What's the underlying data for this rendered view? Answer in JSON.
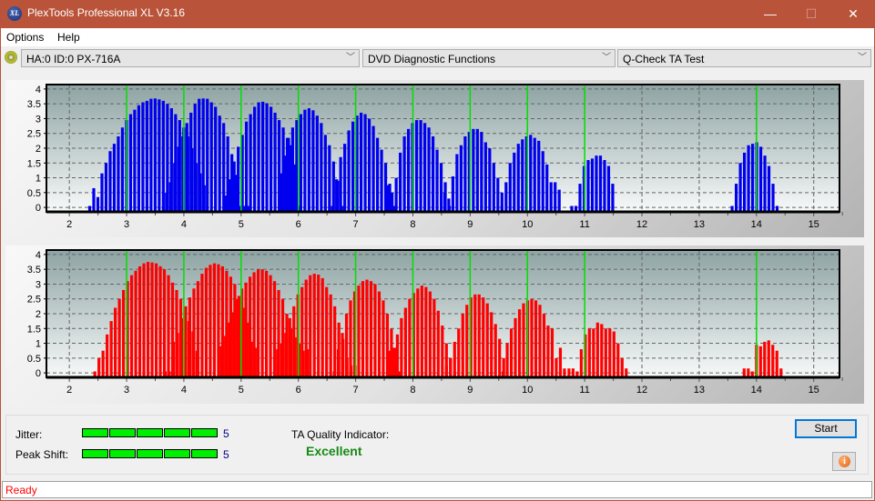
{
  "window": {
    "title": "PlexTools Professional XL V3.16",
    "app_icon_text": "XL",
    "minimize_glyph": "—",
    "maximize_glyph": "☐",
    "close_glyph": "✕"
  },
  "menu": [
    {
      "label": "Options"
    },
    {
      "label": "Help"
    }
  ],
  "toolbar": {
    "drive_select": "HA:0 ID:0  PX-716A",
    "function_select": "DVD Diagnostic Functions",
    "test_select": "Q-Check TA Test",
    "dropdown_glyph": "﹀"
  },
  "results": {
    "jitter_label": "Jitter:",
    "jitter_value": "5",
    "jitter_segments": 5,
    "peak_shift_label": "Peak Shift:",
    "peak_shift_value": "5",
    "peak_shift_segments": 5,
    "ta_label": "TA Quality Indicator:",
    "ta_value": "Excellent",
    "start_label": "Start",
    "info_glyph": "i"
  },
  "status": {
    "text": "Ready"
  },
  "colors": {
    "titlebar": "#b95339",
    "top_bars": "#0000ee",
    "bottom_bars": "#ff0000",
    "marker_lines": "#00e000",
    "meter_fill": "#00ee00",
    "quality_text": "#168a16",
    "status_text": "#ff0000"
  },
  "chart_data": [
    {
      "type": "bar",
      "name": "TA histogram (land / top)",
      "xlabel": "",
      "ylabel": "",
      "xlim": [
        1.6,
        15.45
      ],
      "ylim": [
        -0.15,
        4.15
      ],
      "xticks": [
        2,
        3,
        4,
        5,
        6,
        7,
        8,
        9,
        10,
        11,
        12,
        13,
        14,
        15
      ],
      "yticks": [
        0,
        0.5,
        1,
        1.5,
        2,
        2.5,
        3,
        3.5,
        4
      ],
      "ytick_labels": [
        "0",
        "0.5",
        "1",
        "1.5",
        "2",
        "2.5",
        "3",
        "3.5",
        "4"
      ],
      "grid": true,
      "reference_lines": [
        3,
        4,
        5,
        6,
        7,
        8,
        9,
        10,
        11,
        14
      ],
      "groups": [
        {
          "start": 2.33,
          "values": [
            0.05,
            0.65,
            0.35,
            1.15,
            1.5,
            1.9,
            2.15,
            2.4,
            2.7,
            2.95,
            3.15,
            3.3,
            3.45,
            3.55,
            3.6,
            3.67,
            3.68,
            3.65,
            3.6,
            3.5,
            3.35,
            3.15,
            2.95,
            2.7,
            2.4,
            2.0,
            1.5,
            1.15,
            0.75
          ]
        },
        {
          "start": 3.67,
          "values": [
            0.5,
            0.85,
            1.5,
            2.05,
            2.4,
            2.85,
            3.2,
            3.5,
            3.67,
            3.68,
            3.67,
            3.55,
            3.4,
            3.1,
            2.85,
            2.4,
            1.8,
            1.1,
            0.05,
            0.05,
            0.05
          ]
        },
        {
          "start": 4.71,
          "values": [
            0.4,
            0.95,
            1.55,
            2.05,
            2.45,
            2.9,
            3.15,
            3.4,
            3.55,
            3.57,
            3.52,
            3.4,
            3.2,
            2.95,
            2.7,
            2.35,
            2.1,
            1.45,
            0.05
          ]
        },
        {
          "start": 5.66,
          "values": [
            1.15,
            1.75,
            2.35,
            2.7,
            2.95,
            3.15,
            3.3,
            3.35,
            3.28,
            3.1,
            2.85,
            2.45,
            2.1,
            1.55,
            0.9,
            0.05
          ]
        },
        {
          "start": 6.57,
          "values": [
            0.05,
            0.95,
            1.7,
            2.15,
            2.6,
            2.9,
            3.1,
            3.2,
            3.15,
            3.0,
            2.75,
            2.35,
            1.95,
            1.5,
            0.8,
            0.05
          ]
        },
        {
          "start": 7.54,
          "values": [
            0.75,
            0.5,
            1.0,
            1.85,
            2.4,
            2.65,
            2.85,
            2.95,
            2.95,
            2.85,
            2.7,
            2.4,
            1.95,
            1.5,
            0.85,
            0.05
          ]
        },
        {
          "start": 8.53,
          "values": [
            0.5,
            0.3,
            1.05,
            1.8,
            2.1,
            2.4,
            2.55,
            2.65,
            2.65,
            2.55,
            2.2,
            2.0,
            1.5,
            1.0,
            0.05
          ]
        },
        {
          "start": 9.53,
          "values": [
            0.5,
            0.85,
            1.5,
            1.85,
            2.15,
            2.3,
            2.4,
            2.45,
            2.35,
            2.25,
            1.9,
            1.45,
            0.85,
            0.85,
            0.6
          ]
        },
        {
          "start": 10.75,
          "values": [
            0.05,
            0.05,
            0.8,
            1.4,
            1.6,
            1.65,
            1.75,
            1.75,
            1.6,
            1.4,
            0.8
          ]
        },
        {
          "start": 13.55,
          "values": [
            0.05,
            0.8,
            1.5,
            1.85,
            2.1,
            2.15,
            2.2,
            2.05,
            1.75,
            1.4,
            0.8,
            0.05
          ]
        }
      ]
    },
    {
      "type": "bar",
      "name": "TA histogram (groove / bottom)",
      "xlabel": "",
      "ylabel": "",
      "xlim": [
        1.6,
        15.45
      ],
      "ylim": [
        -0.15,
        4.15
      ],
      "xticks": [
        2,
        3,
        4,
        5,
        6,
        7,
        8,
        9,
        10,
        11,
        12,
        13,
        14,
        15
      ],
      "yticks": [
        0,
        0.5,
        1,
        1.5,
        2,
        2.5,
        3,
        3.5,
        4
      ],
      "ytick_labels": [
        "0",
        "0.5",
        "1",
        "1.5",
        "2",
        "2.5",
        "3",
        "3.5",
        "4"
      ],
      "grid": true,
      "reference_lines": [
        3,
        4,
        5,
        6,
        7,
        8,
        9,
        10,
        11,
        14
      ],
      "groups": [
        {
          "start": 2.42,
          "values": [
            0.05,
            0.5,
            0.75,
            1.3,
            1.75,
            2.2,
            2.5,
            2.8,
            3.1,
            3.3,
            3.45,
            3.6,
            3.7,
            3.75,
            3.73,
            3.7,
            3.6,
            3.5,
            3.3,
            3.05,
            2.8,
            2.5,
            2.1,
            1.75,
            1.4,
            0.75
          ]
        },
        {
          "start": 3.65,
          "values": [
            0.05,
            0.05,
            1.05,
            1.35,
            1.85,
            2.25,
            2.55,
            2.85,
            3.1,
            3.35,
            3.55,
            3.65,
            3.7,
            3.67,
            3.6,
            3.45,
            3.25,
            3.0,
            2.6,
            2.2,
            1.7,
            1.05,
            0.85
          ]
        },
        {
          "start": 4.63,
          "values": [
            0.9,
            1.25,
            1.7,
            2.05,
            2.5,
            2.85,
            3.05,
            3.25,
            3.4,
            3.5,
            3.5,
            3.45,
            3.3,
            3.1,
            2.8,
            2.5,
            2.0,
            1.5,
            1.2,
            1.0,
            0.75,
            0.8
          ]
        },
        {
          "start": 5.61,
          "values": [
            0.8,
            1.0,
            1.35,
            1.85,
            2.25,
            2.65,
            2.9,
            3.15,
            3.3,
            3.35,
            3.32,
            3.2,
            2.9,
            2.65,
            2.25,
            1.7,
            1.15,
            0.5,
            0.25,
            0.25
          ]
        },
        {
          "start": 6.6,
          "values": [
            0.05,
            0.8,
            1.35,
            2.0,
            2.45,
            2.75,
            2.95,
            3.1,
            3.15,
            3.1,
            3.0,
            2.75,
            2.45,
            2.0,
            1.5,
            0.85,
            0.05
          ]
        },
        {
          "start": 7.56,
          "values": [
            0.75,
            0.85,
            1.3,
            1.85,
            2.2,
            2.5,
            2.7,
            2.85,
            2.95,
            2.9,
            2.75,
            2.5,
            2.1,
            1.6,
            1.0,
            0.5,
            0.05
          ]
        },
        {
          "start": 8.56,
          "values": [
            0.25,
            0.5,
            1.05,
            1.5,
            2.0,
            2.3,
            2.55,
            2.65,
            2.65,
            2.55,
            2.35,
            2.05,
            1.65,
            1.15,
            0.5
          ]
        },
        {
          "start": 9.55,
          "values": [
            0.05,
            1.0,
            1.5,
            1.85,
            2.15,
            2.35,
            2.45,
            2.5,
            2.45,
            2.3,
            2.0,
            1.6,
            1.5,
            0.5,
            0.85,
            0.15
          ]
        },
        {
          "start": 10.7,
          "values": [
            0.15,
            0.15,
            0.05,
            0.8,
            1.3,
            1.5,
            1.5,
            1.7,
            1.65,
            1.5,
            1.5,
            1.4,
            1.0,
            0.5,
            0.15
          ]
        },
        {
          "start": 13.76,
          "values": [
            0.15,
            0.15,
            0.05,
            0.95,
            0.9,
            1.05,
            1.1,
            0.95,
            0.75,
            0.15
          ]
        }
      ]
    }
  ]
}
